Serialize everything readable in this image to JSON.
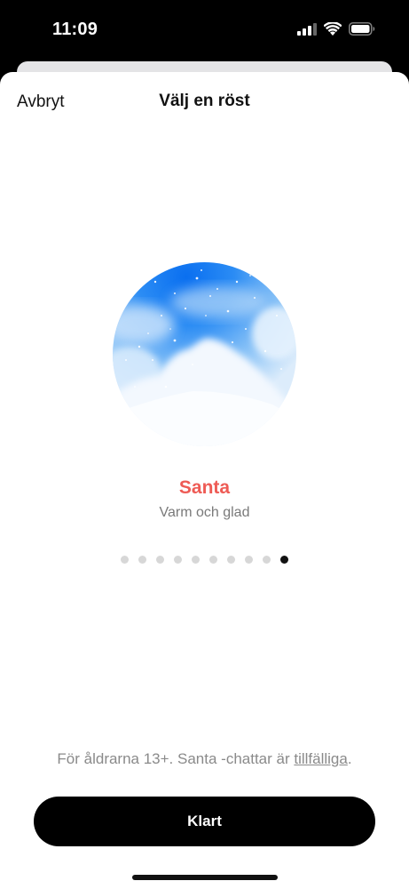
{
  "status_bar": {
    "time": "11:09"
  },
  "sheet": {
    "cancel_label": "Avbryt",
    "title": "Välj en röst"
  },
  "voice": {
    "name": "Santa",
    "description": "Varm och glad",
    "name_color": "#ee5b55",
    "page_count": 10,
    "active_page": 10
  },
  "footer": {
    "note_prefix": "För åldrarna 13+. Santa -chattar är ",
    "note_link": "tillfälliga",
    "note_suffix": ".",
    "done_label": "Klart"
  }
}
